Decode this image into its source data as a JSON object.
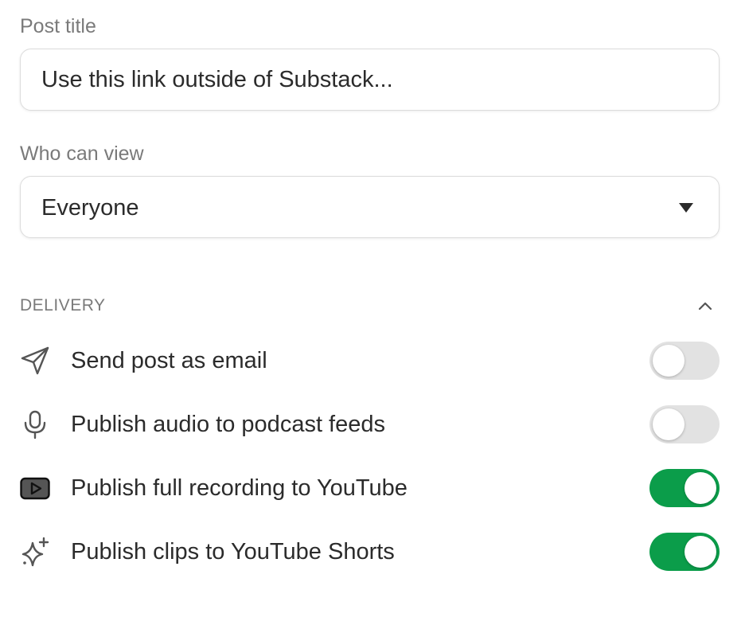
{
  "post_title": {
    "label": "Post title",
    "value": "Use this link outside of Substack..."
  },
  "who_can_view": {
    "label": "Who can view",
    "selected": "Everyone"
  },
  "delivery": {
    "title": "DELIVERY",
    "collapse_icon": "chevron-up-icon",
    "items": [
      {
        "icon": "send-icon",
        "label": "Send post as email",
        "enabled": false
      },
      {
        "icon": "microphone-icon",
        "label": "Publish audio to podcast feeds",
        "enabled": false
      },
      {
        "icon": "youtube-icon",
        "label": "Publish full recording to YouTube",
        "enabled": true
      },
      {
        "icon": "sparkle-icon",
        "label": "Publish clips to YouTube Shorts",
        "enabled": true
      }
    ]
  },
  "colors": {
    "toggle_on": "#0b9d4a",
    "toggle_off": "#e2e2e2",
    "label_gray": "#7a7a7a",
    "text": "#2b2b2b"
  }
}
